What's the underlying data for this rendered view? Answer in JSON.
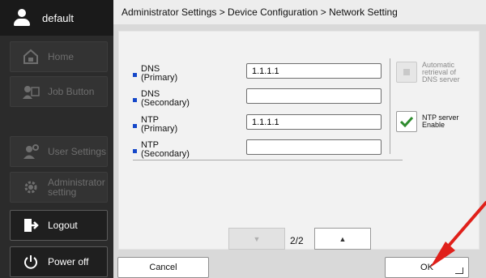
{
  "user": {
    "name": "default",
    "icon": "user-icon"
  },
  "sidebar": {
    "items": [
      {
        "label": "Home",
        "icon": "home-icon"
      },
      {
        "label": "Job Button",
        "icon": "job-button-icon"
      },
      {
        "label": "User Settings",
        "icon": "user-settings-icon"
      },
      {
        "label": "Administrator setting",
        "icon": "gear-icon"
      },
      {
        "label": "Logout",
        "icon": "logout-icon"
      },
      {
        "label": "Power off",
        "icon": "power-icon"
      }
    ]
  },
  "breadcrumb": "Administrator Settings > Device Configuration > Network Setting",
  "fields": {
    "dns_primary": {
      "label_top": "DNS",
      "label_bottom": "(Primary)",
      "value": "1.1.1.1"
    },
    "dns_secondary": {
      "label_top": "DNS",
      "label_bottom": "(Secondary)",
      "value": ""
    },
    "ntp_primary": {
      "label_top": "NTP",
      "label_bottom": "(Primary)",
      "value": "1.1.1.1"
    },
    "ntp_secondary": {
      "label_top": "NTP",
      "label_bottom": "(Secondary)",
      "value": ""
    }
  },
  "options": {
    "auto_dns": {
      "label_lines": [
        "Automatic",
        "retrieval of",
        "DNS server"
      ],
      "checked": false
    },
    "ntp_enable": {
      "label_lines": [
        "NTP server",
        "Enable"
      ],
      "checked": true
    }
  },
  "pager": {
    "text": "2/2",
    "prev_icon": "triangle-down-icon",
    "next_icon": "triangle-up-icon"
  },
  "footer": {
    "cancel_label": "Cancel",
    "ok_label": "OK"
  },
  "colors": {
    "sidebar_bg": "#2b2b2b",
    "accent_blue": "#1547c9",
    "check_green": "#2e8b2e",
    "annotation_red": "#e0201a"
  }
}
